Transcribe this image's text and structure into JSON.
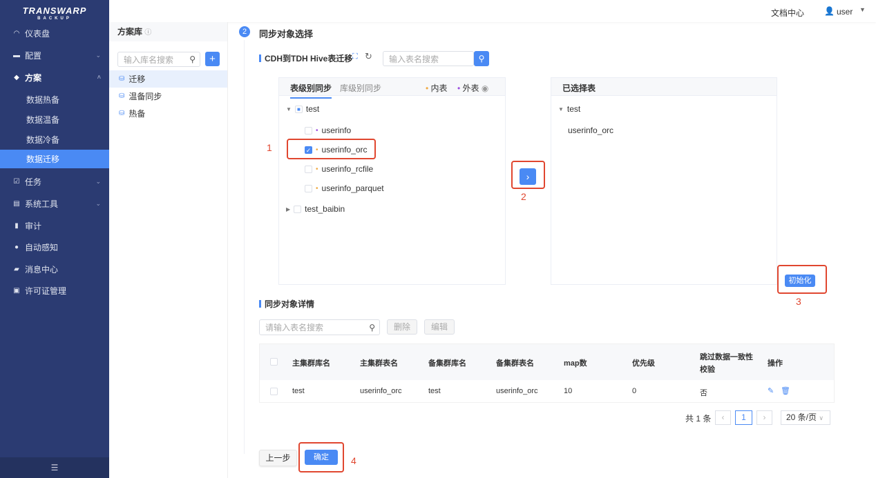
{
  "logo": {
    "brand": "TRANSWARP",
    "sub": "BACKUP"
  },
  "sidebar": {
    "items": [
      {
        "label": "仪表盘",
        "icon": "dashboard-icon"
      },
      {
        "label": "配置",
        "icon": "config-icon"
      },
      {
        "label": "方案",
        "icon": "cube-icon"
      },
      {
        "label": "数据热备"
      },
      {
        "label": "数据温备"
      },
      {
        "label": "数据冷备"
      },
      {
        "label": "数据迁移"
      },
      {
        "label": "任务",
        "icon": "task-icon"
      },
      {
        "label": "系统工具",
        "icon": "tools-icon"
      },
      {
        "label": "审计",
        "icon": "audit-icon"
      },
      {
        "label": "自动感知",
        "icon": "sense-icon"
      },
      {
        "label": "消息中心",
        "icon": "message-icon"
      },
      {
        "label": "许可证管理",
        "icon": "license-icon"
      }
    ],
    "collapse": "☰"
  },
  "topbar": {
    "docs": "文档中心",
    "user": "user"
  },
  "library": {
    "title": "方案库",
    "search_placeholder": "输入库名搜索",
    "add": "+",
    "items": [
      "迁移",
      "温备同步",
      "热备"
    ]
  },
  "step": {
    "num": "2",
    "title": "同步对象选择"
  },
  "section": {
    "title": "CDH到TDH Hive表迁移",
    "search_placeholder": "输入表名搜索"
  },
  "source": {
    "tabs": [
      "表级别同步",
      "库级别同步"
    ],
    "legend": [
      "内表",
      "外表"
    ],
    "tree": [
      {
        "name": "test",
        "children": [
          {
            "name": "userinfo",
            "type": "external",
            "checked": false
          },
          {
            "name": "userinfo_orc",
            "type": "internal",
            "checked": true
          },
          {
            "name": "userinfo_rcfile",
            "type": "internal",
            "checked": false
          },
          {
            "name": "userinfo_parquet",
            "type": "internal",
            "checked": false
          }
        ]
      },
      {
        "name": "test_baibin"
      }
    ]
  },
  "target": {
    "title": "已选择表",
    "db": "test",
    "table": "userinfo_orc",
    "init": "初始化"
  },
  "annotations": [
    "1",
    "2",
    "3",
    "4"
  ],
  "details": {
    "title": "同步对象详情",
    "search_placeholder": "请输入表名搜索",
    "delete": "删除",
    "edit": "编辑",
    "columns": [
      "主集群库名",
      "主集群表名",
      "备集群库名",
      "备集群表名",
      "map数",
      "优先级",
      "跳过数据一致性校验",
      "操作"
    ],
    "rows": [
      [
        "test",
        "userinfo_orc",
        "test",
        "userinfo_orc",
        "10",
        "0",
        "否"
      ]
    ]
  },
  "pagination": {
    "total": "共 1 条",
    "page": "1",
    "size": "20 条/页"
  },
  "footer": {
    "prev": "上一步",
    "confirm": "确定"
  },
  "colors": {
    "sidebar": "#2b3b72",
    "accent": "#4a8af4",
    "annotation": "#e0462f",
    "internal": "#f0a941",
    "external": "#9b4de0"
  }
}
